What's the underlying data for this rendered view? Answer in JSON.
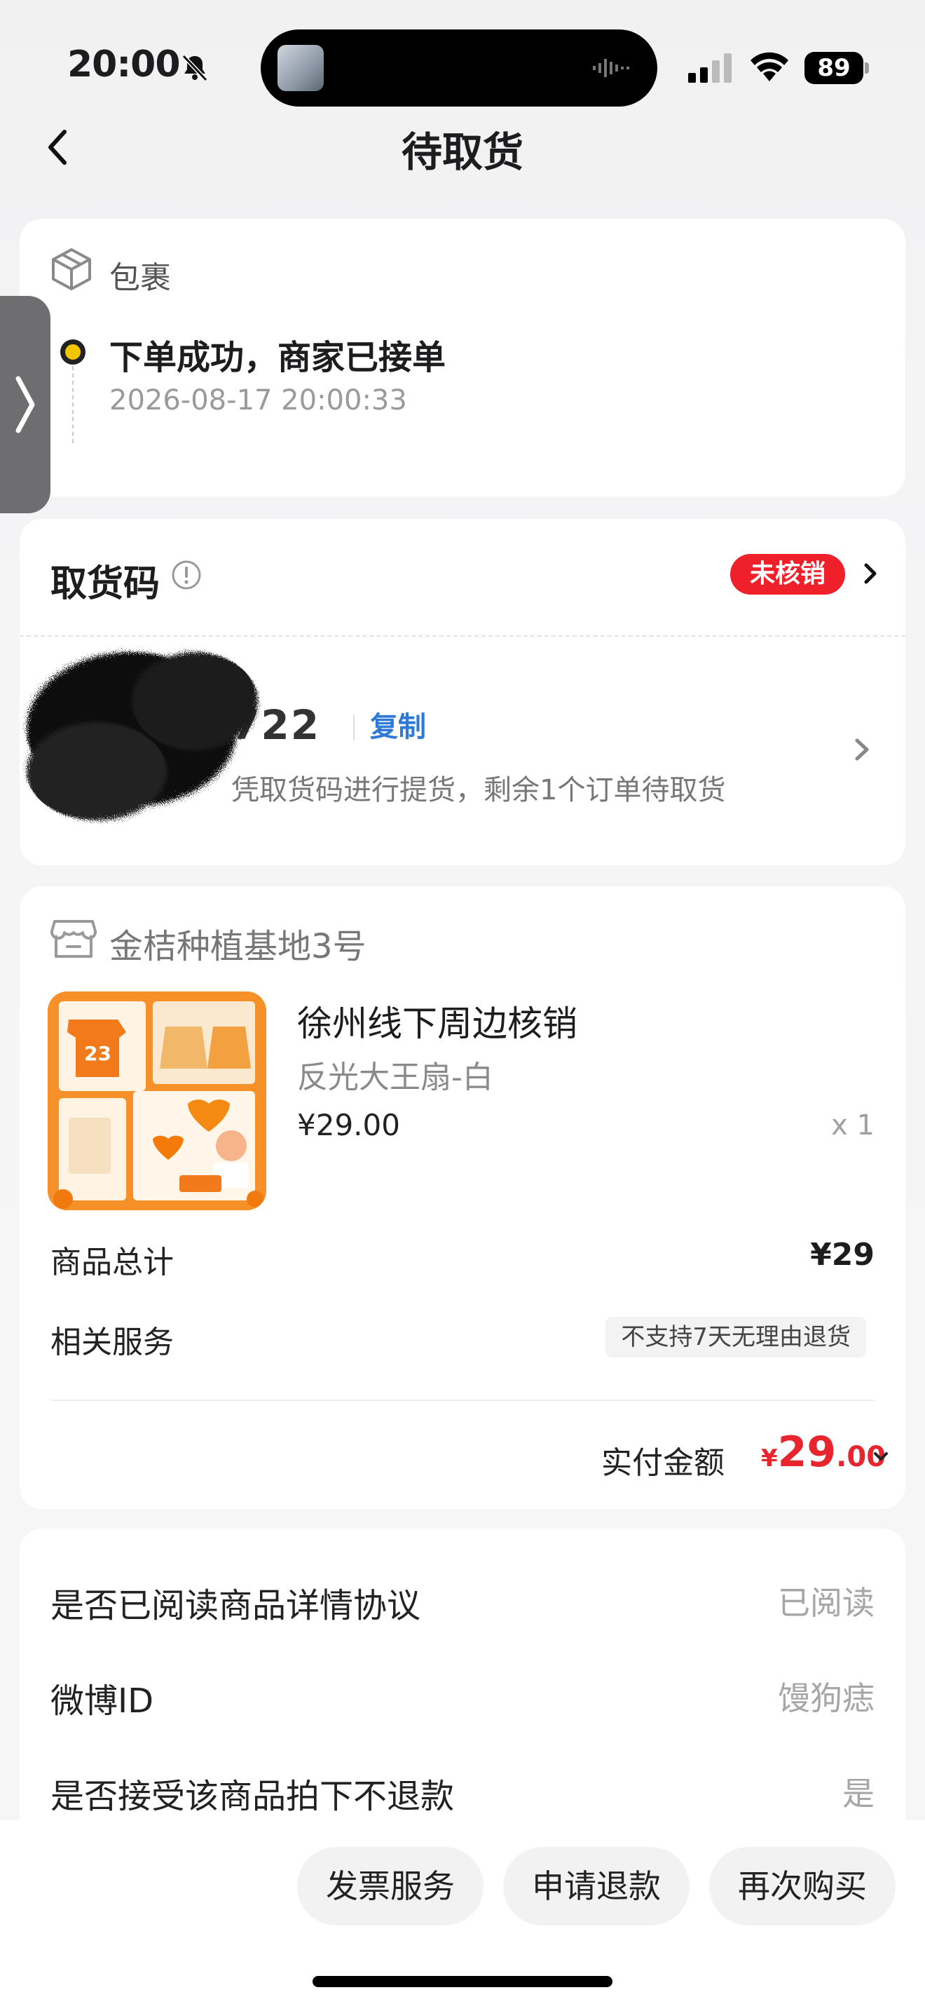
{
  "status_bar": {
    "time": "20:00",
    "battery": "89"
  },
  "nav": {
    "title": "待取货"
  },
  "package": {
    "label": "包裹",
    "status_title": "下单成功，商家已接单",
    "status_time": "2026-08-17 20:00:33"
  },
  "pickup": {
    "title": "取货码",
    "badge": "未核销",
    "code_partial": "722",
    "copy_label": "复制",
    "hint": "凭取货码进行提货，剩余1个订单待取货"
  },
  "order": {
    "shop_name": "金桔种植基地3号",
    "product_title": "徐州线下周边核销",
    "product_variant": "反光大王扇-白",
    "product_price": "¥29.00",
    "product_qty": "x 1",
    "total_label": "商品总计",
    "total_value": "¥29",
    "service_label": "相关服务",
    "service_tag": "不支持7天无理由退货",
    "paid_label": "实付金额",
    "paid_currency": "¥",
    "paid_int": "29",
    "paid_dec": ".00"
  },
  "info": {
    "rows": [
      {
        "key": "是否已阅读商品详情协议",
        "value": "已阅读"
      },
      {
        "key": "微博ID",
        "value": "馒狗痣"
      },
      {
        "key": "是否接受该商品拍下不退款",
        "value": "是"
      }
    ]
  },
  "actions": {
    "invoice": "发票服务",
    "refund": "申请退款",
    "rebuy": "再次购买"
  },
  "colors": {
    "accent_red": "#e8242c",
    "link_blue": "#2f7ad7",
    "badge_red": "#f0202a",
    "dot_yellow": "#f2c500"
  }
}
